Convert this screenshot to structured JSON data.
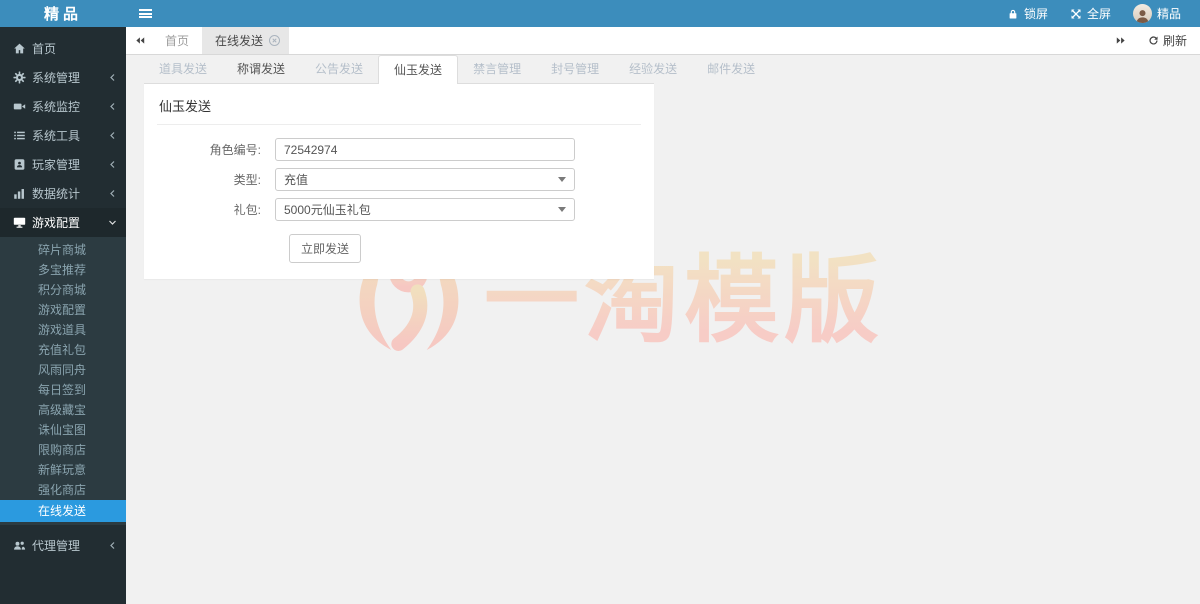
{
  "header": {
    "brand": "精品",
    "lock_label": "锁屏",
    "fullscreen_label": "全屏",
    "user_name": "精品"
  },
  "sidebar": {
    "items": [
      {
        "label": "首页"
      },
      {
        "label": "系统管理"
      },
      {
        "label": "系统监控"
      },
      {
        "label": "系统工具"
      },
      {
        "label": "玩家管理"
      },
      {
        "label": "数据统计"
      },
      {
        "label": "游戏配置"
      },
      {
        "label": "代理管理"
      }
    ],
    "expanded_item": "游戏配置",
    "submenu": [
      "碎片商城",
      "多宝推荐",
      "积分商城",
      "游戏配置",
      "游戏道具",
      "充值礼包",
      "风雨同舟",
      "每日签到",
      "高级藏宝",
      "诛仙宝图",
      "限购商店",
      "新鲜玩意",
      "强化商店",
      "在线发送"
    ],
    "active_submenu": "在线发送"
  },
  "breadcrumb": {
    "home": "首页",
    "current": "在线发送",
    "refresh_label": "刷新"
  },
  "tabs": {
    "items": [
      "道具发送",
      "称谓发送",
      "公告发送",
      "仙玉发送",
      "禁言管理",
      "封号管理",
      "经验发送",
      "邮件发送"
    ],
    "active": "仙玉发送"
  },
  "form": {
    "title": "仙玉发送",
    "fields": [
      {
        "label": "角色编号:",
        "control": "input",
        "value": "72542974"
      },
      {
        "label": "类型:",
        "control": "select",
        "value": "充值"
      },
      {
        "label": "礼包:",
        "control": "select",
        "value": "5000元仙玉礼包"
      }
    ],
    "submit_label": "立即发送"
  },
  "watermark": {
    "text": "一淘模版"
  },
  "colors": {
    "navbar": "#3c8dbc",
    "sidebar": "#222d32",
    "submenu_bg": "#2c3b41",
    "active_menu": "#2b9adf",
    "page_bg": "#f1f1f1",
    "watermark_top": "#f2e2c3",
    "watermark_bottom": "#f7ccc6"
  }
}
